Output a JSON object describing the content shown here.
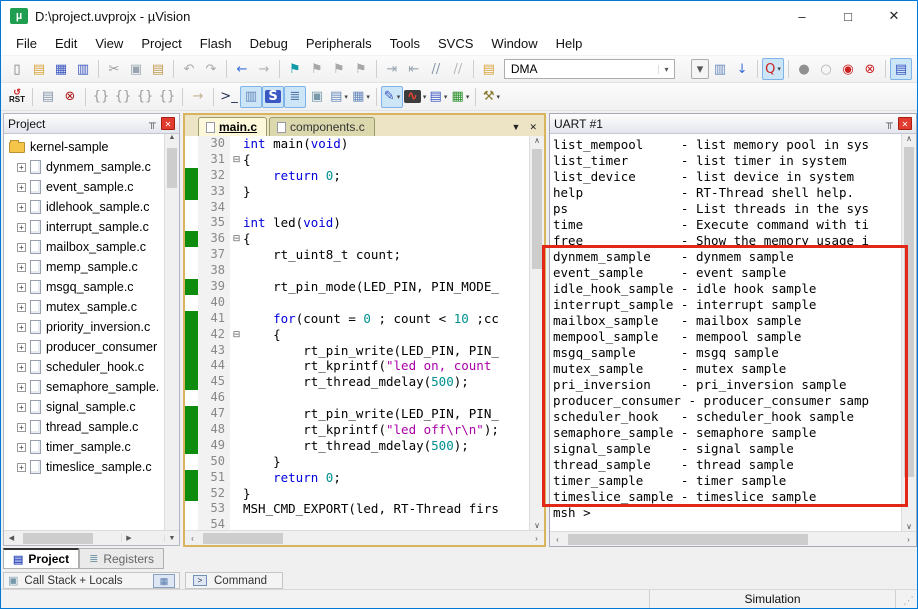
{
  "window": {
    "title": "D:\\project.uvprojx - µVision",
    "controls": {
      "minimize": "–",
      "maximize": "□",
      "close": "✕"
    }
  },
  "menu": [
    "File",
    "Edit",
    "View",
    "Project",
    "Flash",
    "Debug",
    "Peripherals",
    "Tools",
    "SVCS",
    "Window",
    "Help"
  ],
  "icons": {
    "pin": "╥",
    "panel_close": "✕",
    "tab_menu": "▼",
    "tab_close": "✕",
    "up": "▲",
    "down": "▼",
    "left": "◀",
    "right": "▶",
    "chev_up": "∧",
    "chev_down": "∨",
    "chev_left": "‹",
    "chev_right": "›",
    "project_tab": "▤",
    "registers_tab": "≣",
    "callstack": "▣",
    "memory_btn": "▦",
    "command_prompt": ">",
    "grip": "⋰",
    "fold_open": "⊟"
  },
  "toolbar1": [
    {
      "name": "new-file-icon",
      "g": "▯",
      "c": "#777777"
    },
    {
      "name": "open-file-icon",
      "g": "▤",
      "c": "#d9a43c"
    },
    {
      "name": "save-icon",
      "g": "▦",
      "c": "#3a55c0"
    },
    {
      "name": "save-all-icon",
      "g": "▥",
      "c": "#3a55c0"
    },
    {
      "name": "cut-icon",
      "g": "✂",
      "c": "#999999",
      "sep": true
    },
    {
      "name": "copy-icon",
      "g": "▣",
      "c": "#99a4b0"
    },
    {
      "name": "paste-icon",
      "g": "▤",
      "c": "#c09a50"
    },
    {
      "name": "undo-icon",
      "g": "↶",
      "c": "#aaaaaa",
      "sep": true
    },
    {
      "name": "redo-icon",
      "g": "↷",
      "c": "#aaaaaa"
    },
    {
      "name": "navigate-back-icon",
      "g": "←",
      "c": "#3a6fd8",
      "sep": true
    },
    {
      "name": "navigate-forward-icon",
      "g": "→",
      "c": "#b0b0b0"
    },
    {
      "name": "bookmark-toggle-icon",
      "g": "⚑",
      "c": "#0e9aa7",
      "sep": true
    },
    {
      "name": "bookmark-next-icon",
      "g": "⚑",
      "c": "#a8a8a8"
    },
    {
      "name": "bookmark-prev-icon",
      "g": "⚑",
      "c": "#a8a8a8"
    },
    {
      "name": "bookmark-clear-icon",
      "g": "⚑",
      "c": "#a8a8a8"
    },
    {
      "name": "indent-right-icon",
      "g": "⇥",
      "c": "#99a4b0",
      "sep": true
    },
    {
      "name": "indent-left-icon",
      "g": "⇤",
      "c": "#99a4b0"
    },
    {
      "name": "comment-icon",
      "g": "//",
      "c": "#8898aa"
    },
    {
      "name": "uncomment-icon",
      "g": "//",
      "c": "#b8b8b8"
    },
    {
      "name": "find-in-files-folder-icon",
      "g": "▤",
      "c": "#d9a43c",
      "sep": true
    },
    {
      "kind": "combo",
      "name": "search-combobox",
      "value": "DMA"
    },
    {
      "name": "search-dropdown-icon",
      "g": "▾",
      "c": "#555555",
      "box": true,
      "gap": true
    },
    {
      "name": "find-in-files-icon",
      "g": "▥",
      "c": "#6688bb"
    },
    {
      "name": "incremental-find-icon",
      "g": "↓",
      "c": "#3a6fd8"
    },
    {
      "name": "quick-search-icon",
      "g": "Q",
      "c": "#cc2222",
      "act": true,
      "dd": true,
      "sep": true
    },
    {
      "name": "breakpoint-insert-icon",
      "g": "●",
      "c": "#909090",
      "sep": true
    },
    {
      "name": "breakpoint-enable-icon",
      "g": "○",
      "c": "#b0b0b0"
    },
    {
      "name": "breakpoint-disable-icon",
      "g": "◉",
      "c": "#cc2222"
    },
    {
      "name": "breakpoint-kill-all-icon",
      "g": "⊗",
      "c": "#cc2222"
    },
    {
      "name": "project-window-icon",
      "g": "▤",
      "c": "#3a55c0",
      "act": true,
      "sep": true
    }
  ],
  "toolbar2": [
    {
      "kind": "rst",
      "name": "reset-cpu-icon",
      "label": "RST"
    },
    {
      "name": "build-output-icon",
      "g": "▤",
      "c": "#8898aa",
      "sep": true
    },
    {
      "name": "stop-debug-icon",
      "g": "⊗",
      "c": "#b01818"
    },
    {
      "name": "step-icon",
      "g": "{}",
      "c": "#999999",
      "sep": true
    },
    {
      "name": "step-over-icon",
      "g": "{}",
      "c": "#999999"
    },
    {
      "name": "step-out-icon",
      "g": "{}",
      "c": "#999999"
    },
    {
      "name": "run-to-line-icon",
      "g": "{}",
      "c": "#999999"
    },
    {
      "name": "run-icon",
      "g": "→",
      "c": "#c0b490",
      "sep": true
    },
    {
      "name": "command-window-icon",
      "g": ">_",
      "c": "#203050",
      "sep": true
    },
    {
      "name": "disassembly-window-icon",
      "g": "▥",
      "c": "#6688bb",
      "act": true
    },
    {
      "name": "serial-window-icon",
      "g": "S",
      "c": "#ffffff",
      "bgc": "#3a57c4",
      "act": true
    },
    {
      "name": "memory-window-icon",
      "g": "≣",
      "c": "#5577aa",
      "act": true
    },
    {
      "name": "call-stack-window-icon",
      "g": "▣",
      "c": "#7799aa"
    },
    {
      "name": "watch-window-icon",
      "g": "▤",
      "c": "#6688bb",
      "dd": true
    },
    {
      "name": "memory-windows-icon",
      "g": "▦",
      "c": "#6688bb",
      "dd": true
    },
    {
      "name": "serial-windows-icon",
      "g": "✎",
      "c": "#3a55c0",
      "act": true,
      "dd": true,
      "sep": true
    },
    {
      "name": "logic-analyzer-icon",
      "g": "∿",
      "c": "#ee4433",
      "bgc": "#3c3c3c",
      "dd": true
    },
    {
      "name": "system-viewer-icon",
      "g": "▤",
      "c": "#3a55c0",
      "dd": true
    },
    {
      "name": "peripherals-icon",
      "g": "▦",
      "c": "#2a8f2a",
      "dd": true
    },
    {
      "name": "toolbox-icon",
      "g": "⚒",
      "c": "#8a7a30",
      "sep": true,
      "dd": true
    }
  ],
  "project_panel": {
    "title": "Project",
    "root": "kernel-sample",
    "files": [
      "dynmem_sample.c",
      "event_sample.c",
      "idlehook_sample.c",
      "interrupt_sample.c",
      "mailbox_sample.c",
      "memp_sample.c",
      "msgq_sample.c",
      "mutex_sample.c",
      "priority_inversion.c",
      "producer_consumer",
      "scheduler_hook.c",
      "semaphore_sample.",
      "signal_sample.c",
      "thread_sample.c",
      "timer_sample.c",
      "timeslice_sample.c"
    ],
    "tabs": [
      {
        "label": "Project",
        "active": true
      },
      {
        "label": "Registers",
        "active": false
      }
    ]
  },
  "bottom": {
    "callstack": "Call Stack + Locals",
    "command": "Command"
  },
  "editor": {
    "tabs": [
      {
        "label": "main.c",
        "active": true
      },
      {
        "label": "components.c",
        "active": false
      }
    ],
    "lines": [
      {
        "n": 30,
        "g": false,
        "f": false,
        "c": [
          [
            "k",
            "int"
          ],
          [
            "p",
            " main("
          ],
          [
            "k",
            "void"
          ],
          [
            "p",
            ")"
          ]
        ]
      },
      {
        "n": 31,
        "g": false,
        "f": true,
        "c": [
          [
            "p",
            "{"
          ]
        ]
      },
      {
        "n": 32,
        "g": true,
        "f": false,
        "c": [
          [
            "p",
            "    "
          ],
          [
            "k",
            "return"
          ],
          [
            "p",
            " "
          ],
          [
            "n",
            "0"
          ],
          [
            "p",
            ";"
          ]
        ]
      },
      {
        "n": 33,
        "g": true,
        "f": false,
        "c": [
          [
            "p",
            "}"
          ]
        ]
      },
      {
        "n": 34,
        "g": false,
        "f": false,
        "c": []
      },
      {
        "n": 35,
        "g": false,
        "f": false,
        "c": [
          [
            "k",
            "int"
          ],
          [
            "p",
            " led("
          ],
          [
            "k",
            "void"
          ],
          [
            "p",
            ")"
          ]
        ]
      },
      {
        "n": 36,
        "g": true,
        "f": true,
        "c": [
          [
            "p",
            "{"
          ]
        ]
      },
      {
        "n": 37,
        "g": false,
        "f": false,
        "c": [
          [
            "p",
            "    rt_uint8_t count;"
          ]
        ]
      },
      {
        "n": 38,
        "g": false,
        "f": false,
        "c": []
      },
      {
        "n": 39,
        "g": true,
        "f": false,
        "c": [
          [
            "p",
            "    rt_pin_mode(LED_PIN, PIN_MODE_"
          ]
        ]
      },
      {
        "n": 40,
        "g": false,
        "f": false,
        "c": []
      },
      {
        "n": 41,
        "g": true,
        "f": false,
        "c": [
          [
            "p",
            "    "
          ],
          [
            "k",
            "for"
          ],
          [
            "p",
            "(count = "
          ],
          [
            "n",
            "0"
          ],
          [
            "p",
            " ; count < "
          ],
          [
            "n",
            "10"
          ],
          [
            "p",
            " ;cc"
          ]
        ]
      },
      {
        "n": 42,
        "g": true,
        "f": true,
        "c": [
          [
            "p",
            "    {"
          ]
        ]
      },
      {
        "n": 43,
        "g": true,
        "f": false,
        "c": [
          [
            "p",
            "        rt_pin_write(LED_PIN, PIN_"
          ]
        ]
      },
      {
        "n": 44,
        "g": true,
        "f": false,
        "c": [
          [
            "p",
            "        rt_kprintf("
          ],
          [
            "s",
            "\"led on, count"
          ]
        ]
      },
      {
        "n": 45,
        "g": true,
        "f": false,
        "c": [
          [
            "p",
            "        rt_thread_mdelay("
          ],
          [
            "n",
            "500"
          ],
          [
            "p",
            ");"
          ]
        ]
      },
      {
        "n": 46,
        "g": false,
        "f": false,
        "c": []
      },
      {
        "n": 47,
        "g": true,
        "f": false,
        "c": [
          [
            "p",
            "        rt_pin_write(LED_PIN, PIN_"
          ]
        ]
      },
      {
        "n": 48,
        "g": true,
        "f": false,
        "c": [
          [
            "p",
            "        rt_kprintf("
          ],
          [
            "s",
            "\"led off\\r\\n\""
          ],
          [
            "p",
            ");"
          ]
        ]
      },
      {
        "n": 49,
        "g": true,
        "f": false,
        "c": [
          [
            "p",
            "        rt_thread_mdelay("
          ],
          [
            "n",
            "500"
          ],
          [
            "p",
            ");"
          ]
        ]
      },
      {
        "n": 50,
        "g": false,
        "f": false,
        "c": [
          [
            "p",
            "    }"
          ]
        ]
      },
      {
        "n": 51,
        "g": true,
        "f": false,
        "c": [
          [
            "p",
            "    "
          ],
          [
            "k",
            "return"
          ],
          [
            "p",
            " "
          ],
          [
            "n",
            "0"
          ],
          [
            "p",
            ";"
          ]
        ]
      },
      {
        "n": 52,
        "g": true,
        "f": false,
        "c": [
          [
            "p",
            "}"
          ]
        ]
      },
      {
        "n": 53,
        "g": false,
        "f": false,
        "c": [
          [
            "p",
            "MSH_CMD_EXPORT(led, RT-Thread firs"
          ]
        ]
      },
      {
        "n": 54,
        "g": false,
        "f": false,
        "c": []
      }
    ]
  },
  "uart": {
    "title": "UART #1",
    "lines": [
      "list_mempool     - list memory pool in sys",
      "list_timer       - list timer in system",
      "list_device      - list device in system",
      "help             - RT-Thread shell help.",
      "ps               - List threads in the sys",
      "time             - Execute command with ti",
      "free             - Show the memory usage i",
      "dynmem_sample    - dynmem sample",
      "event_sample     - event sample",
      "idle_hook_sample - idle hook sample",
      "interrupt_sample - interrupt sample",
      "mailbox_sample   - mailbox sample",
      "mempool_sample   - mempool sample",
      "msgq_sample      - msgq sample",
      "mutex_sample     - mutex sample",
      "pri_inversion    - pri_inversion sample",
      "producer_consumer - producer_consumer samp",
      "scheduler_hook   - scheduler_hook sample",
      "semaphore_sample - semaphore sample",
      "signal_sample    - signal sample",
      "thread_sample    - thread sample",
      "timer_sample     - timer sample",
      "timeslice_sample - timeslice sample",
      "",
      "msh >"
    ]
  },
  "status": {
    "text": "Simulation"
  },
  "colors": {
    "annotation_red": "#e22718",
    "execution_green": "#0e8c0e",
    "keyword_blue": "#0000dd",
    "number_teal": "#009090",
    "string_purple": "#aa00aa",
    "active_icon_bg": "#cde6f7",
    "window_border": "#0078d7"
  }
}
